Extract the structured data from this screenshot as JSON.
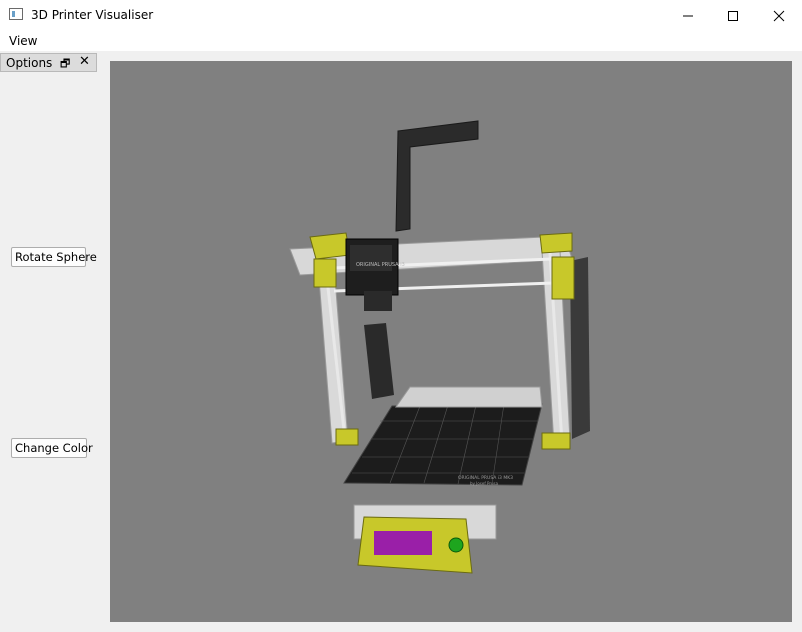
{
  "window": {
    "title": "3D Printer Visualiser",
    "minimize_icon": "minimize-icon",
    "maximize_icon": "maximize-icon",
    "close_icon": "close-icon"
  },
  "menu": {
    "items": [
      {
        "label": "View"
      }
    ]
  },
  "dock": {
    "title": "Options",
    "float_icon": "float-icon",
    "close_icon": "close-icon"
  },
  "controls": {
    "rotate_label": "Rotate Sphere",
    "color_label": "Change Color"
  },
  "viewport": {
    "background": "#808080",
    "model_accent": "#c8c82a",
    "display_text_color": "#9a1fa8"
  },
  "printer_labels": {
    "nozzle_brand": "ORIGINAL PRUSA i3",
    "bed_brand": "ORIGINAL PRUSA i3 MK3",
    "bed_sub": "by Josef Prusa"
  }
}
